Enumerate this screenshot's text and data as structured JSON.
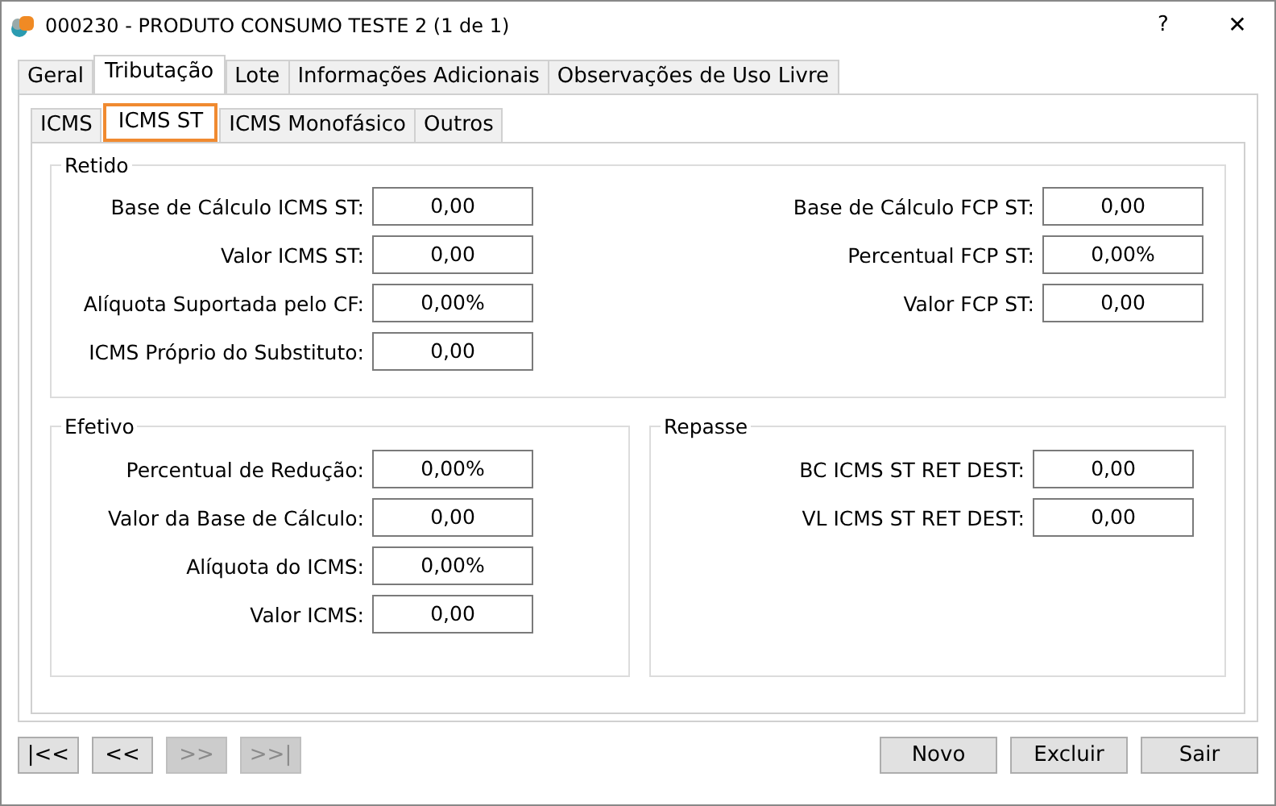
{
  "window": {
    "title": "000230 - PRODUTO CONSUMO TESTE 2 (1 de 1)",
    "help": "?",
    "close": "✕"
  },
  "tabs": [
    {
      "label": "Geral",
      "selected": false
    },
    {
      "label": "Tributação",
      "selected": true
    },
    {
      "label": "Lote",
      "selected": false
    },
    {
      "label": "Informações Adicionais",
      "selected": false
    },
    {
      "label": "Observações de Uso Livre",
      "selected": false
    }
  ],
  "subtabs": [
    {
      "label": "ICMS",
      "selected": false
    },
    {
      "label": "ICMS ST",
      "selected": true
    },
    {
      "label": "ICMS Monofásico",
      "selected": false
    },
    {
      "label": "Outros",
      "selected": false
    }
  ],
  "retido": {
    "title": "Retido",
    "left": [
      {
        "label": "Base de Cálculo ICMS ST:",
        "value": "0,00"
      },
      {
        "label": "Valor ICMS ST:",
        "value": "0,00"
      },
      {
        "label": "Alíquota Suportada pelo CF:",
        "value": "0,00%"
      },
      {
        "label": "ICMS Próprio do Substituto:",
        "value": "0,00"
      }
    ],
    "right": [
      {
        "label": "Base de Cálculo FCP ST:",
        "value": "0,00"
      },
      {
        "label": "Percentual FCP ST:",
        "value": "0,00%"
      },
      {
        "label": "Valor FCP ST:",
        "value": "0,00"
      }
    ]
  },
  "efetivo": {
    "title": "Efetivo",
    "fields": [
      {
        "label": "Percentual de Redução:",
        "value": "0,00%"
      },
      {
        "label": "Valor da Base de Cálculo:",
        "value": "0,00"
      },
      {
        "label": "Alíquota do ICMS:",
        "value": "0,00%"
      },
      {
        "label": "Valor ICMS:",
        "value": "0,00"
      }
    ]
  },
  "repasse": {
    "title": "Repasse",
    "fields": [
      {
        "label": "BC ICMS ST RET DEST:",
        "value": "0,00"
      },
      {
        "label": "VL ICMS ST RET DEST:",
        "value": "0,00"
      }
    ]
  },
  "navigation": [
    {
      "label": "|<<",
      "disabled": false
    },
    {
      "label": "<<",
      "disabled": false
    },
    {
      "label": ">>",
      "disabled": true
    },
    {
      "label": ">>|",
      "disabled": true
    }
  ],
  "actions": [
    "Novo",
    "Excluir",
    "Sair"
  ]
}
